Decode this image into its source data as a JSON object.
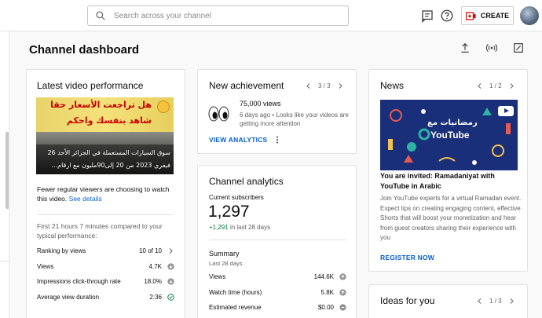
{
  "topbar": {
    "search_placeholder": "Search across your channel",
    "create_label": "CREATE"
  },
  "page": {
    "title": "Channel dashboard"
  },
  "latest_video": {
    "heading": "Latest video performance",
    "thumbnail_text": {
      "line1": "هل تراجعت الأسعار حقا",
      "line2": "شاهد بنفسك واحكم",
      "line3": "سوق السيارات المستعملة في الجزائر الأحد 26",
      "line4": "فيفري 2023 من 20 إلى90مليون مع ارقام..."
    },
    "message": "Fewer regular viewers are choosing to watch this video.",
    "see_details": "See details",
    "compare_text": "First 21 hours 7 minutes compared to your typical performance:",
    "metrics": [
      {
        "label": "Ranking by views",
        "value": "10 of 10",
        "icon": "chevron-right-icon"
      },
      {
        "label": "Views",
        "value": "4.7K",
        "icon": "arrow-down-circle-icon"
      },
      {
        "label": "Impressions click-through rate",
        "value": "18.0%",
        "icon": "arrow-down-circle-icon"
      },
      {
        "label": "Average view duration",
        "value": "2:36",
        "icon": "check-circle-icon"
      }
    ]
  },
  "achievement": {
    "heading": "New achievement",
    "pager": "3 / 3",
    "title": "75,000 views",
    "subtitle": "6 days ago • Looks like your videos are getting more attention",
    "action": "VIEW ANALYTICS"
  },
  "analytics": {
    "heading": "Channel analytics",
    "subscribers_label": "Current subscribers",
    "subscribers_value": "1,297",
    "subscribers_change": "+1,291",
    "subscribers_period": "in last 28 days",
    "summary_label": "Summary",
    "summary_period": "Last 28 days",
    "rows": [
      {
        "label": "Views",
        "value": "144.6K",
        "icon": "arrow-up-circle-icon"
      },
      {
        "label": "Watch time (hours)",
        "value": "5.8K",
        "icon": "arrow-up-circle-icon"
      },
      {
        "label": "Estimated revenue",
        "value": "$0.00",
        "icon": "minus-circle-icon"
      }
    ]
  },
  "news": {
    "heading": "News",
    "pager": "1 / 2",
    "image_text_ar": "رمضانيات مع",
    "image_text_en": "YouTube",
    "title": "You are invited: Ramadaniyat with YouTube in Arabic",
    "body": "Join YouTube experts for a virtual Ramadan event. Expect tips on creating engaging content, effective Shorts that will boost your monetization and hear from guest creators sharing their experience with you",
    "action": "REGISTER NOW"
  },
  "ideas": {
    "heading": "Ideas for you",
    "pager": "1 / 3"
  },
  "colors": {
    "accent_blue": "#065fd4",
    "create_red": "#cc0000",
    "positive_green": "#0b8043"
  }
}
